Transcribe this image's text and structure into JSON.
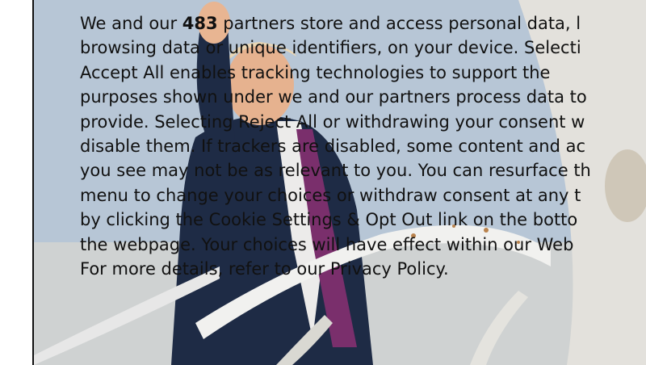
{
  "consent": {
    "line_1_pre": "We and our ",
    "partner_count": "483",
    "line_1_post": " partners store and access personal data, l",
    "line_2": "browsing data or unique identifiers, on your device. Selecti",
    "line_3": "Accept All enables tracking technologies to support the",
    "line_4": "purposes shown under we and our partners process data to",
    "line_5": "provide. Selecting Reject All or withdrawing your consent w",
    "line_6": "disable them. If trackers are disabled, some content and ac",
    "line_7": "you see may not be as relevant to you. You can resurface th",
    "line_8": "menu to change your choices or withdraw consent at any t",
    "line_9_pre": "by clicking the ",
    "cookie_settings_link": "Cookie Settings & Opt Out",
    "line_9_post": " link on the botto",
    "line_10": "the webpage. Your choices will have effect within our Web",
    "line_11_pre": "For more details, refer to our ",
    "privacy_policy_link": "Privacy Policy",
    "line_11_post": "."
  }
}
